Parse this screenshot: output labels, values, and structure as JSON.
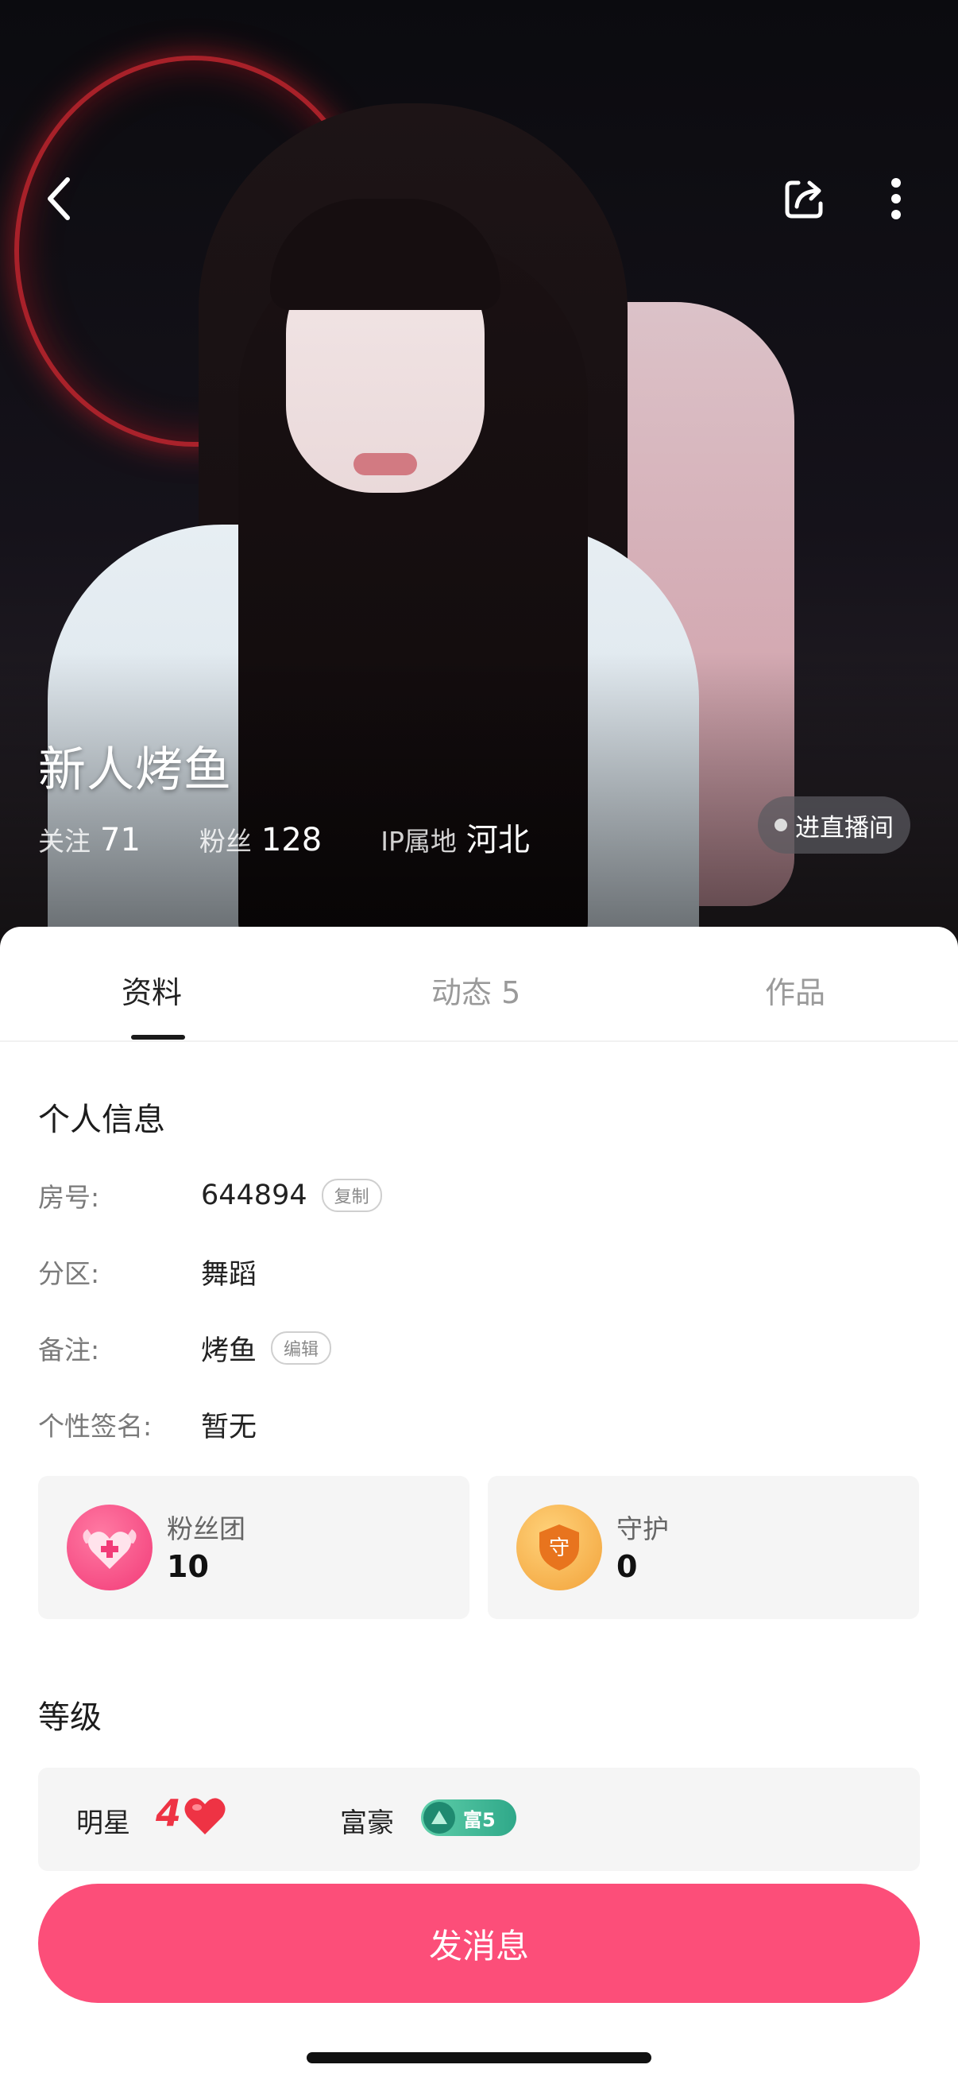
{
  "profile": {
    "name": "新人烤鱼",
    "stats": [
      {
        "label": "关注",
        "value": "71"
      },
      {
        "label": "粉丝",
        "value": "128"
      },
      {
        "label": "IP属地",
        "value": "河北"
      }
    ],
    "live_button": "进直播间"
  },
  "tabs": [
    {
      "label": "资料",
      "active": true
    },
    {
      "label": "动态 5",
      "active": false
    },
    {
      "label": "作品",
      "active": false
    }
  ],
  "personal_info": {
    "title": "个人信息",
    "rows": [
      {
        "label": "房号:",
        "value": "644894",
        "tag": "复制"
      },
      {
        "label": "分区:",
        "value": "舞蹈"
      },
      {
        "label": "备注:",
        "value": "烤鱼",
        "tag": "编辑"
      },
      {
        "label": "个性签名:",
        "value": "暂无"
      }
    ]
  },
  "cards": {
    "fan_club": {
      "label": "粉丝团",
      "value": "10",
      "icon": "heart-wings-icon"
    },
    "guard": {
      "label": "守护",
      "value": "0",
      "icon_text": "守",
      "icon": "shield-icon"
    }
  },
  "level": {
    "title": "等级",
    "star_label": "明星",
    "star_level": "4",
    "rich_label": "富豪",
    "rich_badge": "富5"
  },
  "send_button": "发消息",
  "colors": {
    "accent": "#fc4e79",
    "star_level": "#ee3344",
    "rich_badge": "#2fa889",
    "fan_badge": "#f23b78",
    "guard_badge": "#f2a23a"
  }
}
